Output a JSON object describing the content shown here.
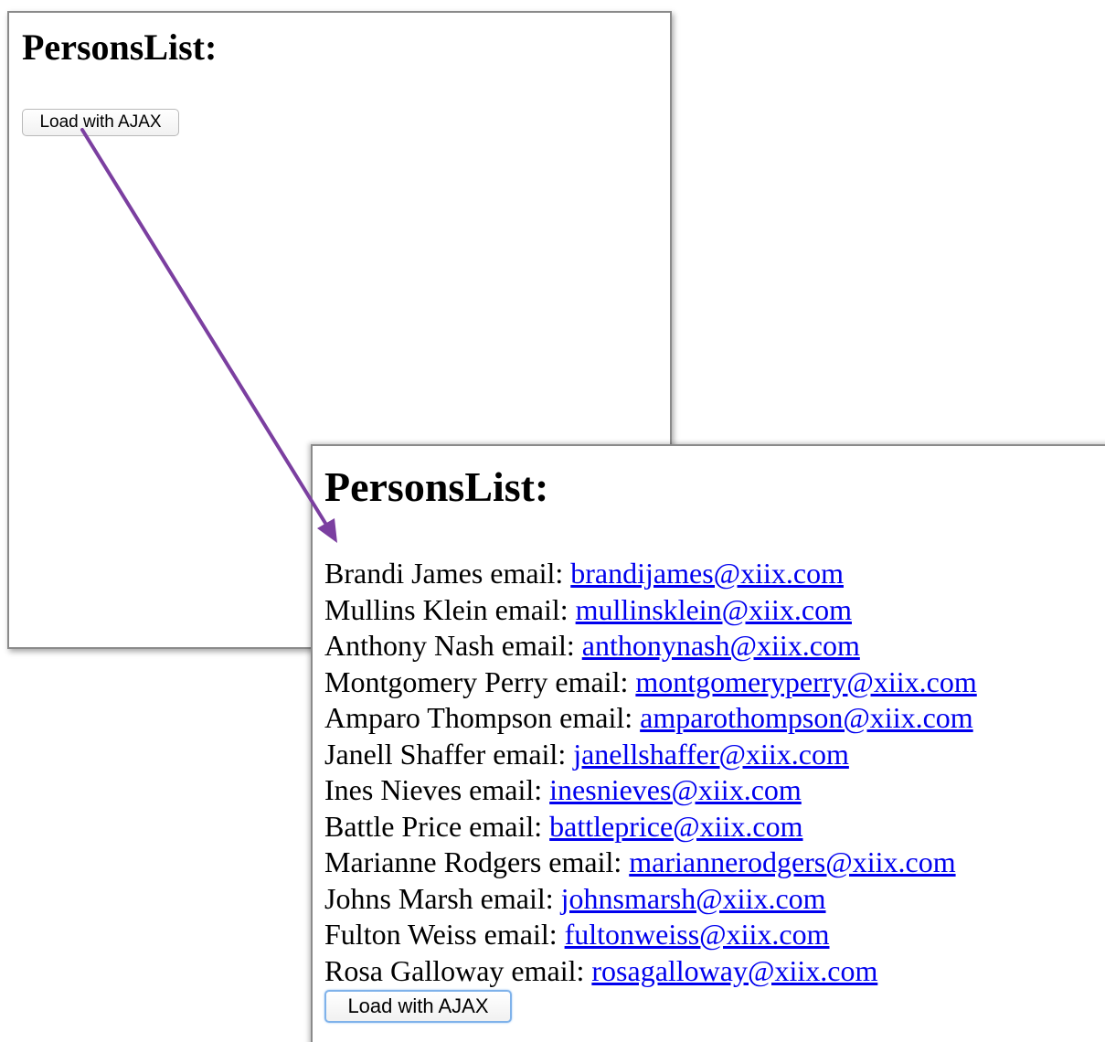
{
  "before": {
    "title": "PersonsList:",
    "button_label": "Load with AJAX"
  },
  "after": {
    "title": "PersonsList:",
    "button_label": "Load with AJAX",
    "persons": [
      {
        "name": "Brandi James",
        "sep": " email: ",
        "email": "brandijames@xiix.com"
      },
      {
        "name": "Mullins Klein",
        "sep": " email: ",
        "email": "mullinsklein@xiix.com"
      },
      {
        "name": "Anthony Nash",
        "sep": " email: ",
        "email": "anthonynash@xiix.com"
      },
      {
        "name": "Montgomery Perry",
        "sep": " email: ",
        "email": "montgomeryperry@xiix.com"
      },
      {
        "name": "Amparo Thompson",
        "sep": " email: ",
        "email": "amparothompson@xiix.com"
      },
      {
        "name": "Janell Shaffer",
        "sep": " email: ",
        "email": "janellshaffer@xiix.com"
      },
      {
        "name": "Ines Nieves",
        "sep": " email: ",
        "email": "inesnieves@xiix.com"
      },
      {
        "name": "Battle Price",
        "sep": " email: ",
        "email": "battleprice@xiix.com"
      },
      {
        "name": "Marianne Rodgers",
        "sep": " email: ",
        "email": "mariannerodgers@xiix.com"
      },
      {
        "name": "Johns Marsh",
        "sep": " email: ",
        "email": "johnsmarsh@xiix.com"
      },
      {
        "name": "Fulton Weiss",
        "sep": " email: ",
        "email": "fultonweiss@xiix.com"
      },
      {
        "name": "Rosa Galloway",
        "sep": " email: ",
        "email": "rosagalloway@xiix.com"
      }
    ]
  },
  "colors": {
    "link": "#0000ee",
    "arrow": "#7b3fa0",
    "focus_ring": "#7fb2ea"
  },
  "icons": {
    "arrow": "flow-arrow-icon"
  }
}
